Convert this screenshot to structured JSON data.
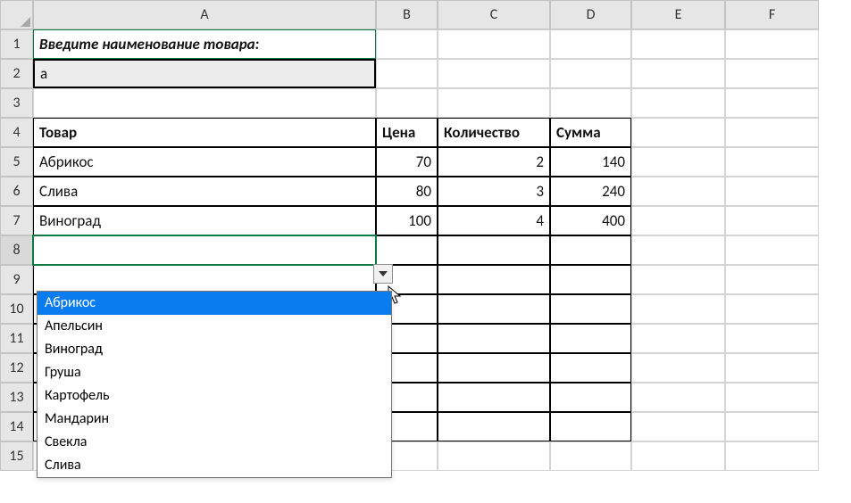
{
  "columns": [
    "A",
    "B",
    "C",
    "D",
    "E",
    "F"
  ],
  "rows": [
    "1",
    "2",
    "3",
    "4",
    "5",
    "6",
    "7",
    "8",
    "9",
    "10",
    "11",
    "12",
    "13",
    "14",
    "15"
  ],
  "a1": "Введите наименование товара:",
  "a2": "а",
  "headers": {
    "товар": "Товар",
    "цена": "Цена",
    "кол": "Количество",
    "сумма": "Сумма"
  },
  "data": [
    {
      "name": "Абрикос",
      "price": "70",
      "qty": "2",
      "sum": "140"
    },
    {
      "name": "Слива",
      "price": "80",
      "qty": "3",
      "sum": "240"
    },
    {
      "name": "Виноград",
      "price": "100",
      "qty": "4",
      "sum": "400"
    }
  ],
  "dropdown": {
    "items": [
      "Абрикос",
      "Апельсин",
      "Виноград",
      "Груша",
      "Картофель",
      "Мандарин",
      "Свекла",
      "Слива"
    ],
    "selected": 0
  }
}
